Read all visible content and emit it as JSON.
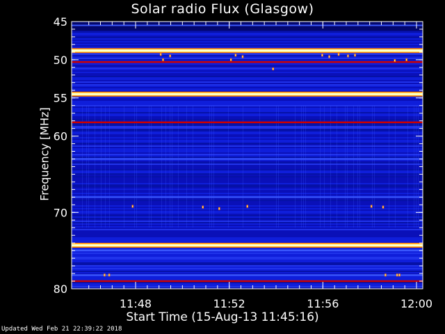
{
  "chart_data": {
    "type": "heatmap",
    "title": "Solar radio Flux (Glasgow)",
    "xlabel": "Start Time (15-Aug-13 11:45:16)",
    "ylabel": "Frequency [MHz]",
    "x_tick_labels": [
      "11:48",
      "11:52",
      "11:56",
      "12:00"
    ],
    "x_ticks_minutes": [
      2.733,
      6.733,
      10.733,
      14.733
    ],
    "x_range_minutes": [
      0,
      15.0
    ],
    "y_tick_labels": [
      "45",
      "50",
      "55",
      "60",
      "70",
      "80"
    ],
    "y_ticks": [
      45,
      50,
      55,
      60,
      70,
      80
    ],
    "ylim": [
      45,
      80
    ],
    "y_inverted": true,
    "grid": false,
    "colormap": [
      "#00004a",
      "#0a14d2",
      "#3c5aff",
      "#cc0000",
      "#ff7800",
      "#ffff96"
    ],
    "frequency_bands": [
      {
        "freq_mhz": 45.5,
        "intensity": 0.45
      },
      {
        "freq_mhz": 48.8,
        "intensity": 0.95
      },
      {
        "freq_mhz": 50.3,
        "intensity": 0.6
      },
      {
        "freq_mhz": 54.5,
        "intensity": 1.0
      },
      {
        "freq_mhz": 58.2,
        "intensity": 0.55
      },
      {
        "freq_mhz": 63.0,
        "intensity": 0.4
      },
      {
        "freq_mhz": 68.0,
        "intensity": 0.38
      },
      {
        "freq_mhz": 74.3,
        "intensity": 1.0
      },
      {
        "freq_mhz": 75.0,
        "intensity": 0.4
      },
      {
        "freq_mhz": 78.2,
        "intensity": 0.45
      },
      {
        "freq_mhz": 79.0,
        "intensity": 0.55
      }
    ],
    "bursts": [
      {
        "t_min": 3.8,
        "freq_mhz": 49.3
      },
      {
        "t_min": 3.9,
        "freq_mhz": 50.0
      },
      {
        "t_min": 4.2,
        "freq_mhz": 49.5
      },
      {
        "t_min": 6.8,
        "freq_mhz": 50.0
      },
      {
        "t_min": 7.0,
        "freq_mhz": 49.4
      },
      {
        "t_min": 7.3,
        "freq_mhz": 49.6
      },
      {
        "t_min": 10.7,
        "freq_mhz": 49.4
      },
      {
        "t_min": 11.0,
        "freq_mhz": 49.6
      },
      {
        "t_min": 11.4,
        "freq_mhz": 49.3
      },
      {
        "t_min": 11.8,
        "freq_mhz": 49.5
      },
      {
        "t_min": 12.1,
        "freq_mhz": 49.4
      },
      {
        "t_min": 13.8,
        "freq_mhz": 50.1
      },
      {
        "t_min": 14.3,
        "freq_mhz": 50.0
      },
      {
        "t_min": 8.6,
        "freq_mhz": 51.2
      },
      {
        "t_min": 2.6,
        "freq_mhz": 69.2
      },
      {
        "t_min": 5.6,
        "freq_mhz": 69.3
      },
      {
        "t_min": 6.3,
        "freq_mhz": 69.5
      },
      {
        "t_min": 7.5,
        "freq_mhz": 69.2
      },
      {
        "t_min": 12.8,
        "freq_mhz": 69.2
      },
      {
        "t_min": 13.3,
        "freq_mhz": 69.3
      },
      {
        "t_min": 1.4,
        "freq_mhz": 78.2
      },
      {
        "t_min": 1.6,
        "freq_mhz": 78.2
      },
      {
        "t_min": 13.4,
        "freq_mhz": 78.2
      },
      {
        "t_min": 13.9,
        "freq_mhz": 78.2
      },
      {
        "t_min": 14.0,
        "freq_mhz": 78.2
      }
    ]
  },
  "footer": {
    "updated": "Updated Wed Feb 21 22:39:22 2018"
  }
}
